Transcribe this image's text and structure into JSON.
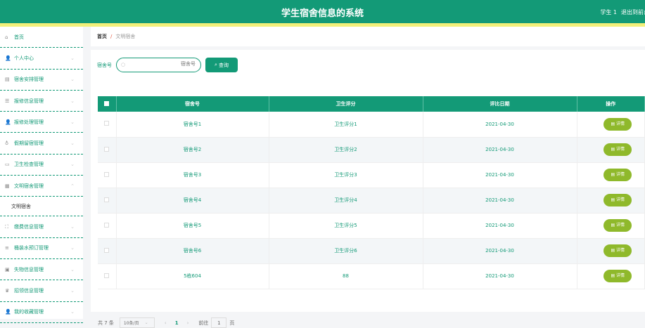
{
  "header": {
    "title": "学生宿舍信息的系统",
    "user": "学生 1",
    "logout": "退出到前台"
  },
  "sidebar": {
    "items": [
      {
        "label": "首页",
        "icon": "home-icon"
      },
      {
        "label": "个人中心",
        "icon": "user-icon"
      },
      {
        "label": "宿舍安排管理",
        "icon": "clipboard-icon"
      },
      {
        "label": "报修信息管理",
        "icon": "sliders-icon"
      },
      {
        "label": "报修处理管理",
        "icon": "user-icon"
      },
      {
        "label": "假期留宿管理",
        "icon": "mic-icon"
      },
      {
        "label": "卫生检查管理",
        "icon": "briefcase-icon"
      },
      {
        "label": "文明宿舍管理",
        "icon": "book-icon"
      }
    ],
    "sub": "文明宿舍",
    "items2": [
      {
        "label": "缴费信息管理",
        "icon": "scan-icon"
      },
      {
        "label": "桶装水预订管理",
        "icon": "list-icon"
      },
      {
        "label": "失物信息管理",
        "icon": "image-icon"
      },
      {
        "label": "招领信息管理",
        "icon": "trophy-icon"
      },
      {
        "label": "我的收藏管理",
        "icon": "user-icon"
      }
    ]
  },
  "breadcrumb": {
    "home": "首页",
    "sep": "/",
    "current": "文明宿舍"
  },
  "search": {
    "label": "宿舍号",
    "placeholder": "宿舍号",
    "button": "查询"
  },
  "table": {
    "headers": [
      "宿舍号",
      "卫生评分",
      "评比日期",
      "操作"
    ],
    "rows": [
      {
        "room": "宿舍号1",
        "score": "卫生评分1",
        "date": "2021-04-30"
      },
      {
        "room": "宿舍号2",
        "score": "卫生评分2",
        "date": "2021-04-30"
      },
      {
        "room": "宿舍号3",
        "score": "卫生评分3",
        "date": "2021-04-30"
      },
      {
        "room": "宿舍号4",
        "score": "卫生评分4",
        "date": "2021-04-30"
      },
      {
        "room": "宿舍号5",
        "score": "卫生评分5",
        "date": "2021-04-30"
      },
      {
        "room": "宿舍号6",
        "score": "卫生评分6",
        "date": "2021-04-30"
      },
      {
        "room": "5栋604",
        "score": "88",
        "date": "2021-04-30"
      }
    ],
    "detail": "详情"
  },
  "pager": {
    "total": "共 7 条",
    "size": "10条/页",
    "page": "1",
    "goto": "前往",
    "goto_value": "1",
    "page_unit": "页"
  }
}
